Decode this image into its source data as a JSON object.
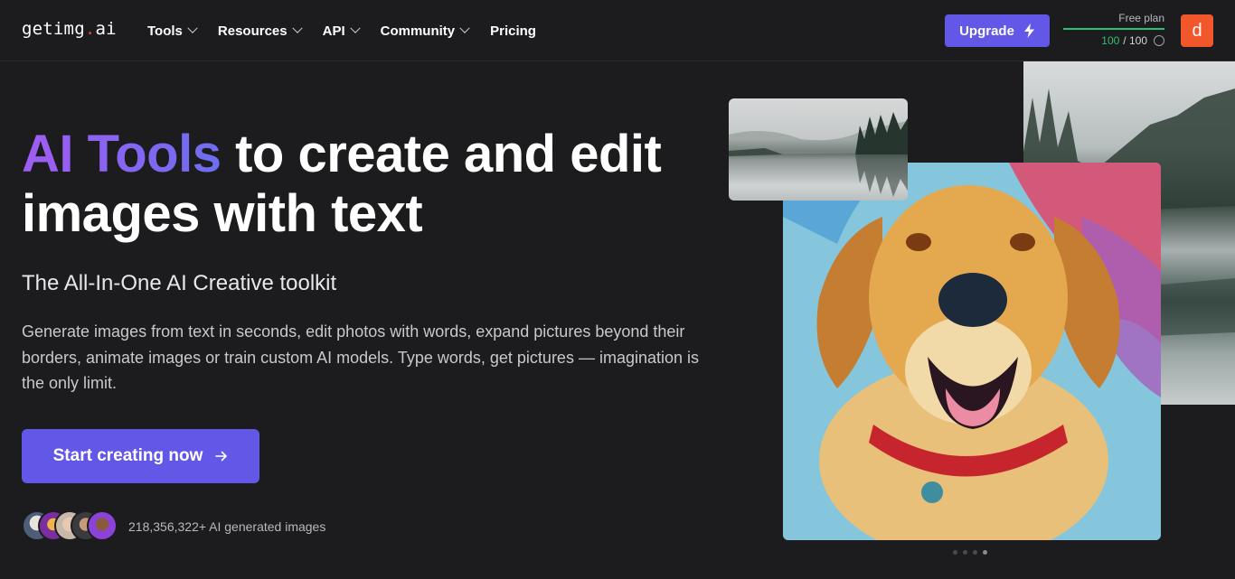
{
  "nav": {
    "logo": {
      "main": "getimg",
      "dot": ".",
      "suffix": "ai"
    },
    "links": [
      {
        "label": "Tools",
        "dropdown": true
      },
      {
        "label": "Resources",
        "dropdown": true
      },
      {
        "label": "API",
        "dropdown": true
      },
      {
        "label": "Community",
        "dropdown": true
      },
      {
        "label": "Pricing",
        "dropdown": false
      }
    ],
    "upgrade_label": "Upgrade",
    "plan": {
      "label": "Free plan",
      "used": "100",
      "total": "/ 100",
      "fraction": 1.0
    },
    "avatar_letter": "d"
  },
  "hero": {
    "title_highlight": "AI Tools",
    "title_rest": " to create and edit images with text",
    "subtitle": "The All-In-One AI Creative toolkit",
    "description": "Generate images from text in seconds, edit photos with words, expand pictures beyond their borders, animate images or train custom AI models. Type words, get pictures — imagination is the only limit.",
    "cta_label": "Start creating now",
    "social_count": "218,356,322+ AI generated images"
  },
  "carousel": {
    "dots": 4,
    "active_index": 3
  },
  "colors": {
    "accent": "#6257e7",
    "background": "#1c1c1e",
    "avatar": "#f2572b",
    "plan_used": "#2fbf71"
  }
}
